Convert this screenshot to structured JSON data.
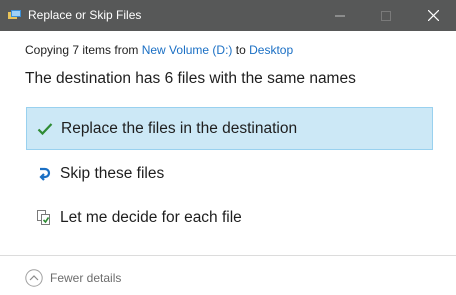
{
  "window": {
    "title": "Replace or Skip Files",
    "titlebar_color": "#575858"
  },
  "copy_info": {
    "prefix": "Copying 7 items from",
    "source": "New Volume (D:)",
    "middle": "to",
    "destination": "Desktop",
    "link_color": "#1a6fc4"
  },
  "headline": "The destination has 6 files with the same names",
  "options": [
    {
      "label": "Replace the files in the destination",
      "icon": "checkmark-icon",
      "selected": true
    },
    {
      "label": "Skip these files",
      "icon": "skip-arrow-icon",
      "selected": false
    },
    {
      "label": "Let me decide for each file",
      "icon": "file-compare-icon",
      "selected": false
    }
  ],
  "footer": {
    "toggle_label": "Fewer details",
    "icon": "chevron-up-icon"
  },
  "colors": {
    "selected_bg": "#cce8f6",
    "selected_border": "#99d1ef",
    "check_green": "#2e8b34",
    "skip_blue": "#1a6fc4"
  }
}
